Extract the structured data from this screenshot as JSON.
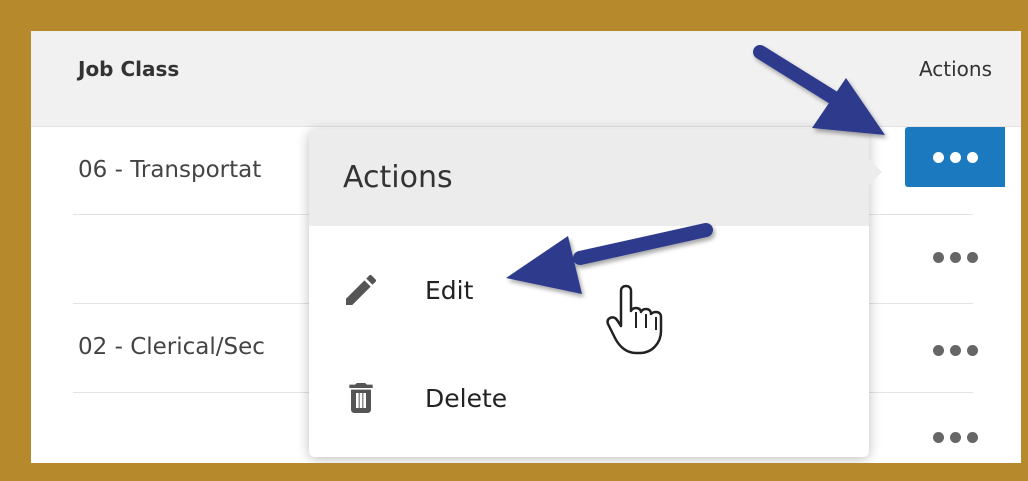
{
  "table": {
    "headers": {
      "job_class": "Job Class",
      "actions": "Actions"
    },
    "rows": [
      {
        "job_class": "06 - Transportat"
      },
      {
        "job_class": ""
      },
      {
        "job_class": "02 - Clerical/Sec"
      },
      {
        "job_class": ""
      }
    ]
  },
  "menu": {
    "title": "Actions",
    "items": [
      {
        "label": "Edit",
        "icon": "pencil-icon"
      },
      {
        "label": "Delete",
        "icon": "trash-icon"
      }
    ]
  },
  "colors": {
    "frame": "#b5892c",
    "accent": "#1a79bf",
    "annotation_arrow": "#2d3a8c"
  }
}
